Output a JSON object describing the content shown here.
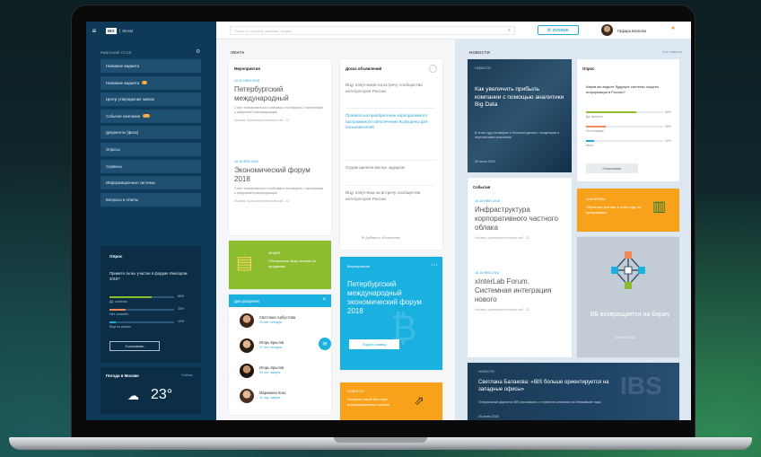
{
  "topbar": {
    "logo": "IBS",
    "logo_sub": "ЕКАМ",
    "search_placeholder": "Поиск по порталу, данным, людям",
    "zvonok_label": "ZVONOK",
    "user_name": "Гафара Волкова"
  },
  "sidebar": {
    "heading": "РАБОЧИЙ СТОЛ",
    "items": [
      {
        "label": "Название виджета",
        "badge": ""
      },
      {
        "label": "Название виджета",
        "badge": "2"
      },
      {
        "label": "Центр утверждения заявок",
        "badge": ""
      },
      {
        "label": "Событие компании",
        "badge": "17"
      },
      {
        "label": "Документы (фиск)",
        "badge": ""
      },
      {
        "label": "Опросы",
        "badge": ""
      },
      {
        "label": "Сервисы",
        "badge": ""
      },
      {
        "label": "Информационные системы",
        "badge": ""
      },
      {
        "label": "Вопросы и ответы",
        "badge": ""
      }
    ],
    "poll": {
      "title": "Опрос",
      "question": "Примете ли вы участие в форуме Иннопром 2018?",
      "options": [
        {
          "label": "Да, конечно",
          "pct": "65%",
          "value": 0.65,
          "color": "#8cbd2e"
        },
        {
          "label": "Нет, спасибо",
          "pct": "25%",
          "value": 0.25,
          "color": "#f08a5d"
        },
        {
          "label": "Еще не решил",
          "pct": "10%",
          "value": 0.1,
          "color": "#26a5d8"
        }
      ],
      "button": "Голосовать"
    },
    "weather": {
      "title": "Погода в Москве",
      "link": "Сейчас",
      "temp": "23°"
    }
  },
  "center": {
    "heading": "ЛЕНТА",
    "events": {
      "title": "Мероприятия",
      "items": [
        {
          "date": "22-24 ИЮН 2018",
          "title": "Петербургский международный",
          "desc": "Стоит познакомиться с кейсами и поговорить с экспертами о цифровой трансформации",
          "place": "Москва, Краснопресненская наб., 12"
        },
        {
          "date": "16-18 ФЕВ 2018",
          "title": "Экономический форум 2018",
          "desc": "Стоит познакомиться с кейсами и поговорить с экспертами о цифровой трансформации",
          "place": "Москва, Краснопресненская наб., 12"
        }
      ]
    },
    "board": {
      "title": "Доска объявлений",
      "items": [
        {
          "text": "Ищу попутчиков на встречу сообщества интеграторов России",
          "blue": false
        },
        {
          "text": "Правила на приобретение корпоративного программного обеспечения выпущены для пользователей",
          "blue": true
        },
        {
          "text": "Отдам щенков милых задаром",
          "blue": false
        },
        {
          "text": "Ищу попутчика на встречу сообщества интеграторов России",
          "blue": false
        }
      ],
      "footer": "Добавить объявление"
    },
    "green": {
      "tag": "АКЦИЯ",
      "text": "Обновление базы знаний по продажам"
    },
    "teal": {
      "tag": "Мероприятие",
      "title": "Петербургский международный экономический форум 2018",
      "button": "Подать заявку"
    },
    "birthdays": {
      "title": "Дни рождения",
      "people": [
        {
          "name": "Светлана Арбустова",
          "status": "23 лет, сегодня"
        },
        {
          "name": "Игорь Крылов",
          "status": "27 лет, сегодня"
        },
        {
          "name": "Игорь Крылов",
          "status": "30 лет, завтра"
        },
        {
          "name": "Марианна Кокс",
          "status": "31 год, завтра"
        }
      ]
    },
    "orange": {
      "tag": "НОВОСТИ",
      "text": "Помните какой был путь информационных систем"
    }
  },
  "right": {
    "heading": "НОВОСТИ",
    "all_link": "Все новости",
    "bigdata": {
      "tag": "НОВОСТИ",
      "title": "Как увеличить прибыль компании с помощью аналитики Big Data",
      "desc": "В этом году поговорим о больших данных, тенденциях и перспективах аналитики",
      "date": "25 июня 2018"
    },
    "poll": {
      "title": "Опрос",
      "question": "Каким вы видите будущее системы защиты информации в России?",
      "options": [
        {
          "label": "Да, конечно",
          "pct": "65%",
          "value": 0.65,
          "color": "#8cbd2e"
        },
        {
          "label": "Не понимаю",
          "pct": "25%",
          "value": 0.25,
          "color": "#f08a5d"
        },
        {
          "label": "Иное",
          "pct": "10%",
          "value": 0.1,
          "color": "#26a5d8"
        }
      ],
      "button": "Голосовать"
    },
    "events": {
      "title": "События",
      "items": [
        {
          "date": "15-18 ИЮН 2018",
          "title": "Инфраструктура корпоративного частного облака",
          "place": "Москва, Краснопресненская наб., 12"
        },
        {
          "date": "16-18 ФЕВ 2018",
          "title": "xInterLab Forum. Системная интеграция нового",
          "place": "Москва, Краснопресненская наб., 12"
        }
      ]
    },
    "orange": {
      "tag": "АНАЛИТИКА",
      "text": "Обучение для вас в этом году по программам"
    },
    "gray": {
      "text": "ВБ возвращается на биржу",
      "date": "25 июня 2018"
    },
    "ibs": {
      "tag": "НОВОСТИ",
      "title": "Светлана Балакова: «IBS больше ориентируется на западные офисы»",
      "desc": "Генеральный директор IBS рассказала о стратегии компании на ближайшие годы",
      "date": "25 июня 2018"
    }
  }
}
